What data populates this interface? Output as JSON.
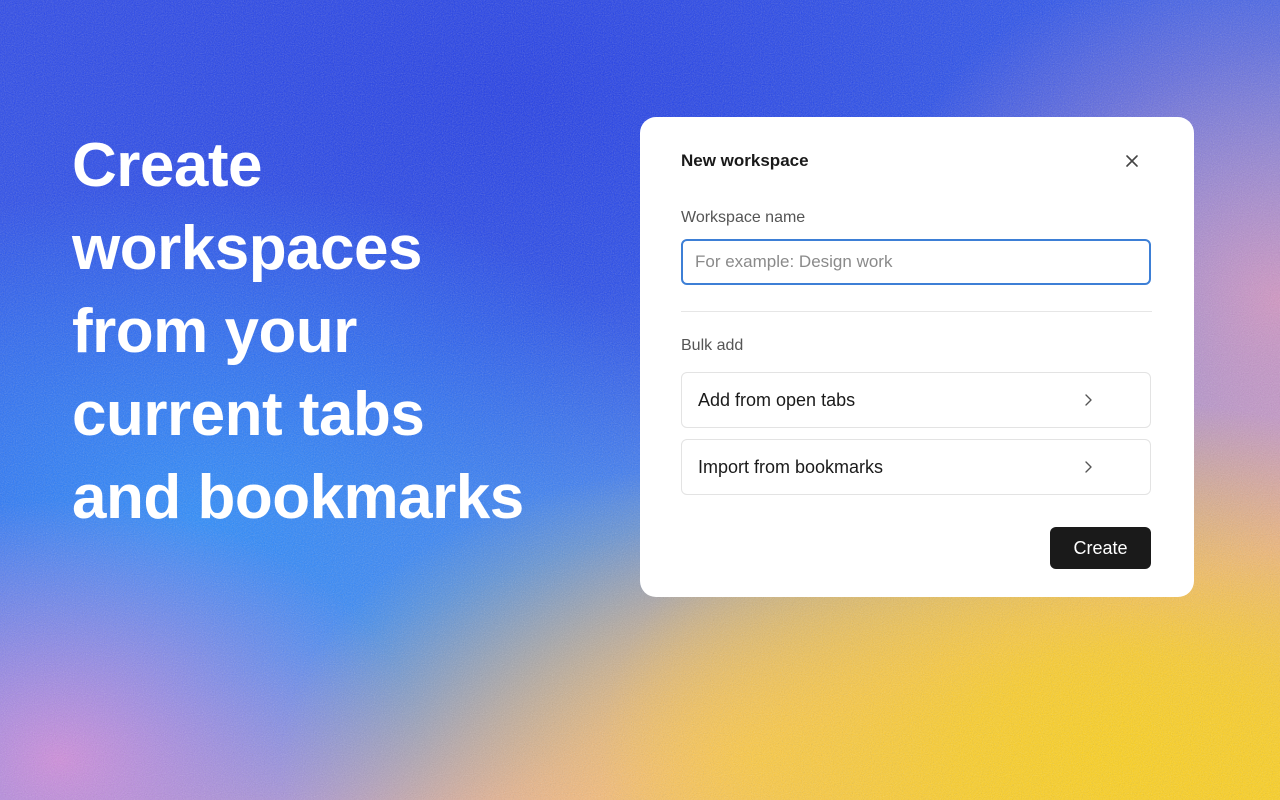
{
  "headline": {
    "lines": [
      "Create",
      "workspaces",
      "from your",
      "current tabs",
      "and bookmarks"
    ]
  },
  "dialog": {
    "title": "New workspace",
    "close_icon": "close-icon",
    "name_field": {
      "label": "Workspace name",
      "value": "",
      "placeholder": "For example: Design work"
    },
    "bulk_add": {
      "label": "Bulk add",
      "options": [
        {
          "label": "Add from open tabs",
          "icon": "chevron-right-icon"
        },
        {
          "label": "Import from bookmarks",
          "icon": "chevron-right-icon"
        }
      ]
    },
    "create_label": "Create"
  },
  "colors": {
    "input_focus_border": "#3d7fd6",
    "primary_button": "#1a1a1a",
    "background_blue": "#2a48ec",
    "background_yellow": "#ffd21a"
  }
}
